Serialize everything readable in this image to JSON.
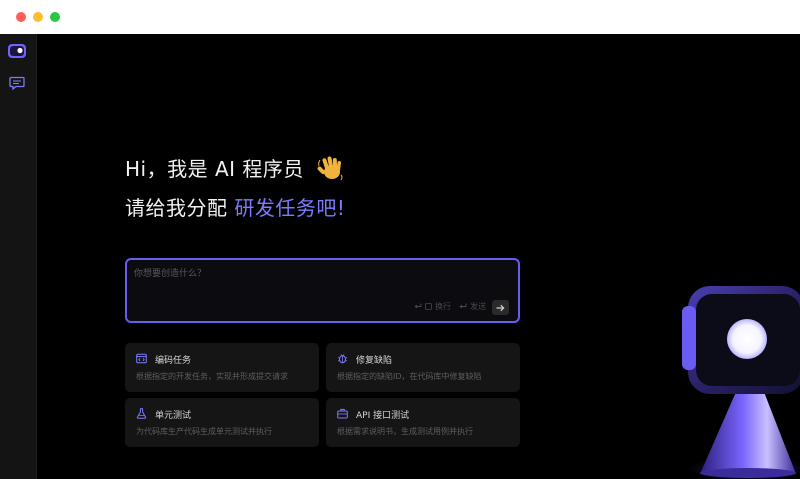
{
  "greeting": {
    "line1": "Hi，我是 AI 程序员",
    "line2_prefix": "请给我分配 ",
    "line2_accent": "研发任务吧!"
  },
  "prompt": {
    "placeholder": "你想要创造什么？",
    "hint_newline": "换行",
    "hint_send": "发送"
  },
  "cards": [
    {
      "title": "编码任务",
      "desc": "根据指定的开发任务，实现并形成提交请求",
      "icon": "code-window-icon"
    },
    {
      "title": "修复缺陷",
      "desc": "根据指定的缺陷ID，在代码库中修复缺陷",
      "icon": "bug-icon"
    },
    {
      "title": "单元测试",
      "desc": "为代码库生产代码生成单元测试并执行",
      "icon": "flask-icon"
    },
    {
      "title": "API 接口测试",
      "desc": "根据需求说明书，生成测试用例并执行",
      "icon": "briefcase-icon"
    }
  ],
  "colors": {
    "accent": "#7c7cff",
    "prompt_border": "#6a5cf0",
    "card_bg": "#151515",
    "rail_bg": "#141414"
  }
}
